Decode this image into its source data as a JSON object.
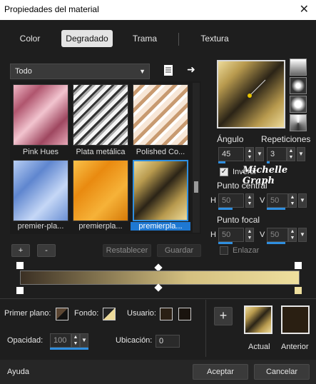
{
  "window": {
    "title": "Propiedades del material"
  },
  "tabs": [
    {
      "label": "Color"
    },
    {
      "label": "Degradado"
    },
    {
      "label": "Trama"
    },
    {
      "label": "Textura"
    }
  ],
  "filter": {
    "value": "Todo"
  },
  "gallery": {
    "items": [
      {
        "label": "Pink Hues"
      },
      {
        "label": "Plata metálica"
      },
      {
        "label": "Polished Co..."
      },
      {
        "label": "premier-pla..."
      },
      {
        "label": "premierpla..."
      },
      {
        "label": "premierpla..."
      }
    ]
  },
  "buttons": {
    "plus": "+",
    "minus": "-",
    "reset": "Restablecer",
    "save": "Guardar"
  },
  "angle": {
    "label": "Ángulo",
    "value": "45"
  },
  "repeat": {
    "label": "Repeticiones",
    "value": "3"
  },
  "invert": {
    "label": "Invertir"
  },
  "watermark": "Michelle Graph",
  "center": {
    "label": "Punto central",
    "h_label": "H",
    "h": "50",
    "v_label": "V",
    "v": "50"
  },
  "focal": {
    "label": "Punto focal",
    "h_label": "H",
    "h": "50",
    "v_label": "V",
    "v": "50"
  },
  "link": {
    "label": "Enlazar"
  },
  "bottom": {
    "foreground_label": "Primer plano:",
    "background_label": "Fondo:",
    "user_label": "Usuario:",
    "opacity_label": "Opacidad:",
    "opacity_value": "100",
    "location_label": "Ubicación:",
    "location_value": "0",
    "current_label": "Actual",
    "previous_label": "Anterior"
  },
  "footer": {
    "help": "Ayuda",
    "ok": "Aceptar",
    "cancel": "Cancelar"
  }
}
